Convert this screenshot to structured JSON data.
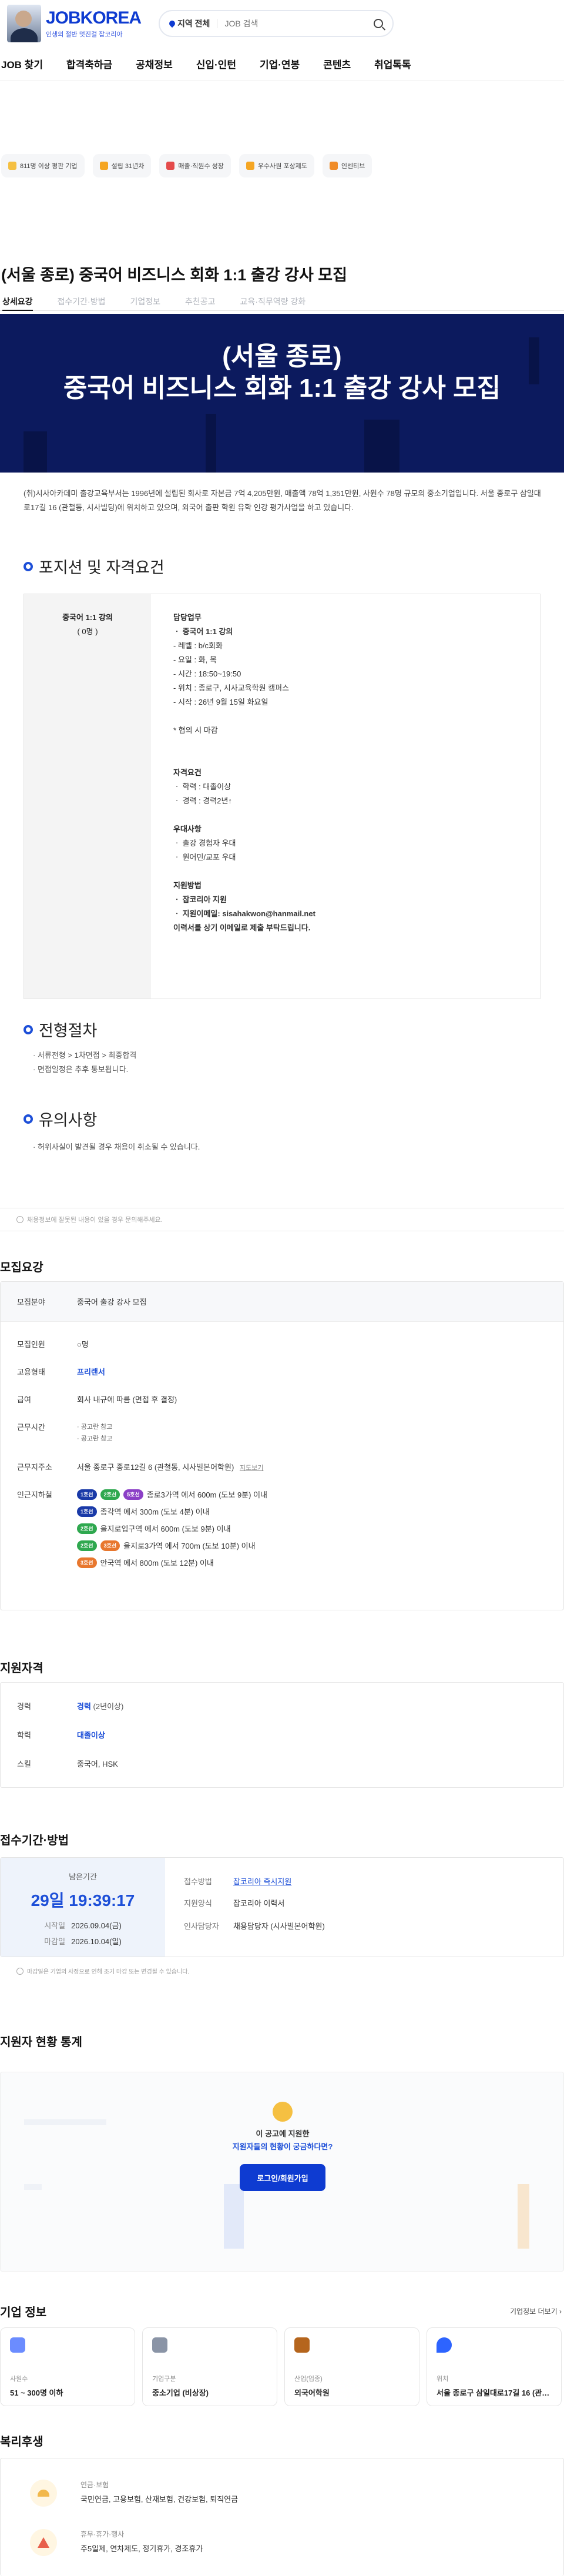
{
  "header": {
    "logo_text": "JOBKOREA",
    "logo_sub": "인생의 절반 멋진걸 잡코리아",
    "location_label": "지역 전체",
    "search_placeholder": "JOB 검색"
  },
  "nav": [
    "JOB 찾기",
    "합격축하금",
    "공채정보",
    "신입·인턴",
    "기업·연봉",
    "콘텐츠",
    "취업톡톡"
  ],
  "benefits": [
    {
      "label": "811명 이상 평판 기업",
      "color": "#f5c042"
    },
    {
      "label": "설립 31년차",
      "color": "#f5a623"
    },
    {
      "label": "매출·직원수 성장",
      "color": "#e44b4b"
    },
    {
      "label": "우수사원 포상제도",
      "color": "#f5a623"
    },
    {
      "label": "인센티브",
      "color": "#f08c28"
    }
  ],
  "job": {
    "title": "(서울 종로) 중국어 비즈니스 회화 1:1 출강 강사 모집",
    "tabs": [
      "상세요강",
      "접수기간·방법",
      "기업정보",
      "추천공고",
      "교육·직무역량 강화"
    ],
    "banner_line1": "(서울 종로)",
    "banner_line2": "중국어 비즈니스 회화 1:1  출강 강사 모집",
    "intro": "(취)시사아카데미 출강교육부서는 1996년에 설립된 회사로 자본금 7억 4,205만원, 매출액 78억 1,351만원, 사원수 78명 규모의 중소기업입니다. 서울 종로구 삼일대로17길 16 (관철동, 시사빌딩)에 위치하고 있으며, 외국어 출판 학원 유학 인강 평가사업을 하고 있습니다."
  },
  "section_titles": {
    "position": "포지션 및 자격요건",
    "process": "전형절차",
    "caution": "유의사항"
  },
  "position": {
    "name": "중국어 1:1 강의",
    "count": "( 0명 )",
    "duties_title": "담당업무",
    "duties": [
      "ㆍ 중국어 1:1 강의",
      "- 레벨 : b/c회화",
      "- 요일 : 화, 목",
      "- 시간 : 18:50~19:50",
      "- 위치 : 종로구, 시사교육학원 캠퍼스",
      "- 시작 : 26년 9월 15일 화요일"
    ],
    "note": "* 협의 시 마감",
    "qual_title": "자격요건",
    "quals": [
      "ㆍ 학력 : 대졸이상",
      "ㆍ 경력 : 경력2년↑"
    ],
    "pref_title": "우대사항",
    "prefs": [
      "ㆍ 출강 경험자 우대",
      "ㆍ 원어민/교포 우대"
    ],
    "apply_title": "지원방법",
    "apply": [
      "ㆍ 잡코리아 지원",
      "ㆍ 지원이메일: sisahakwon@hanmail.net",
      "이력서를 상기 이메일로 제출 부탁드립니다."
    ]
  },
  "process": [
    "· 서류전형 > 1차면접 > 최종합격",
    "· 면접일정은 추후 통보됩니다."
  ],
  "caution": [
    "· 허위사실이 발견될 경우 채용이 취소될 수 있습니다."
  ],
  "notice": "채용정보에 잘못된 내용이 있을 경우 문의해주세요.",
  "summary": {
    "title": "모집요강",
    "field_k": "모집분야",
    "field_v": "중국어 출강 강사 모집",
    "count_k": "모집인원",
    "count_v": "○명",
    "type_k": "고용형태",
    "type_v": "프리랜서",
    "salary_k": "급여",
    "salary_v": "회사 내규에 따름 (면접 후 결정)",
    "hours_k": "근무시간",
    "hours_v": [
      "· 공고란 참고",
      "· 공고란 참고"
    ],
    "place_k": "근무지주소",
    "place_v": "서울 종로구 종로12길 6 (관철동, 시사빌본어학원)",
    "map_label": "지도보기",
    "station_k": "인근지하철",
    "stations": [
      {
        "lines": [
          {
            "n": "1호선",
            "c": "#1a3aa8"
          },
          {
            "n": "2호선",
            "c": "#2fa84f"
          },
          {
            "n": "5호선",
            "c": "#8b3fc6"
          }
        ],
        "text": "종로3가역 에서 600m (도보 9분) 이내"
      },
      {
        "lines": [
          {
            "n": "1호선",
            "c": "#1a3aa8"
          }
        ],
        "text": "종각역 에서 300m (도보 4분) 이내"
      },
      {
        "lines": [
          {
            "n": "2호선",
            "c": "#2fa84f"
          }
        ],
        "text": "을지로입구역 에서 600m (도보 9분) 이내"
      },
      {
        "lines": [
          {
            "n": "2호선",
            "c": "#2fa84f"
          },
          {
            "n": "3호선",
            "c": "#e8772e"
          }
        ],
        "text": "을지로3가역 에서 700m (도보 10분) 이내"
      },
      {
        "lines": [
          {
            "n": "3호선",
            "c": "#e8772e"
          }
        ],
        "text": "안국역 에서 800m (도보 12분) 이내"
      }
    ]
  },
  "qualification": {
    "title": "지원자격",
    "career_k": "경력",
    "career_v": "경력",
    "career_sub": "(2년이상)",
    "edu_k": "학력",
    "edu_v": "대졸이상",
    "skill_k": "스킬",
    "skill_v": "중국어, HSK"
  },
  "period": {
    "title": "접수기간·방법",
    "remain_label": "남은기간",
    "remain": "29일 19:39:17",
    "start_k": "시작일",
    "start_v": "2026.09.04(금)",
    "end_k": "마감일",
    "end_v": "2026.10.04(일)",
    "method_k": "접수방법",
    "method_v": "잡코리아 즉시지원",
    "form_k": "지원양식",
    "form_v": "잡코리아 이력서",
    "hr_k": "인사담당자",
    "hr_v": "채용담당자 (시사빌본어학원)",
    "notice": "마감일은 기업의 사정으로 인해 조기 마감 또는 변경될 수 있습니다."
  },
  "stats": {
    "title": "지원자 현황 통계",
    "q1": "이 공고에 지원한",
    "q2": "지원자들의 현황이 궁금하다면?",
    "btn": "로그인/회원가입"
  },
  "company": {
    "title": "기업 정보",
    "more": "기업정보 더보기",
    "cards": [
      {
        "label": "사원수",
        "value": "51 ~ 300명 이하",
        "color": "#6b8cff"
      },
      {
        "label": "기업구분",
        "value": "중소기업 (비상장)",
        "color": "#8a94a6"
      },
      {
        "label": "산업(업종)",
        "value": "외국어학원",
        "color": "#b5651d"
      },
      {
        "label": "위치",
        "value": "서울 종로구 삼일대로17길 16 (관…",
        "color": "#2d64ff"
      }
    ]
  },
  "welfare": {
    "title": "복리후생",
    "items": [
      {
        "k": "연금·보험",
        "v": "국민연금, 고용보험, 산재보험, 건강보험, 퇴직연금"
      },
      {
        "k": "휴무·휴가·행사",
        "v": "주5일제, 연차제도, 정기휴가, 경조휴가"
      }
    ]
  }
}
